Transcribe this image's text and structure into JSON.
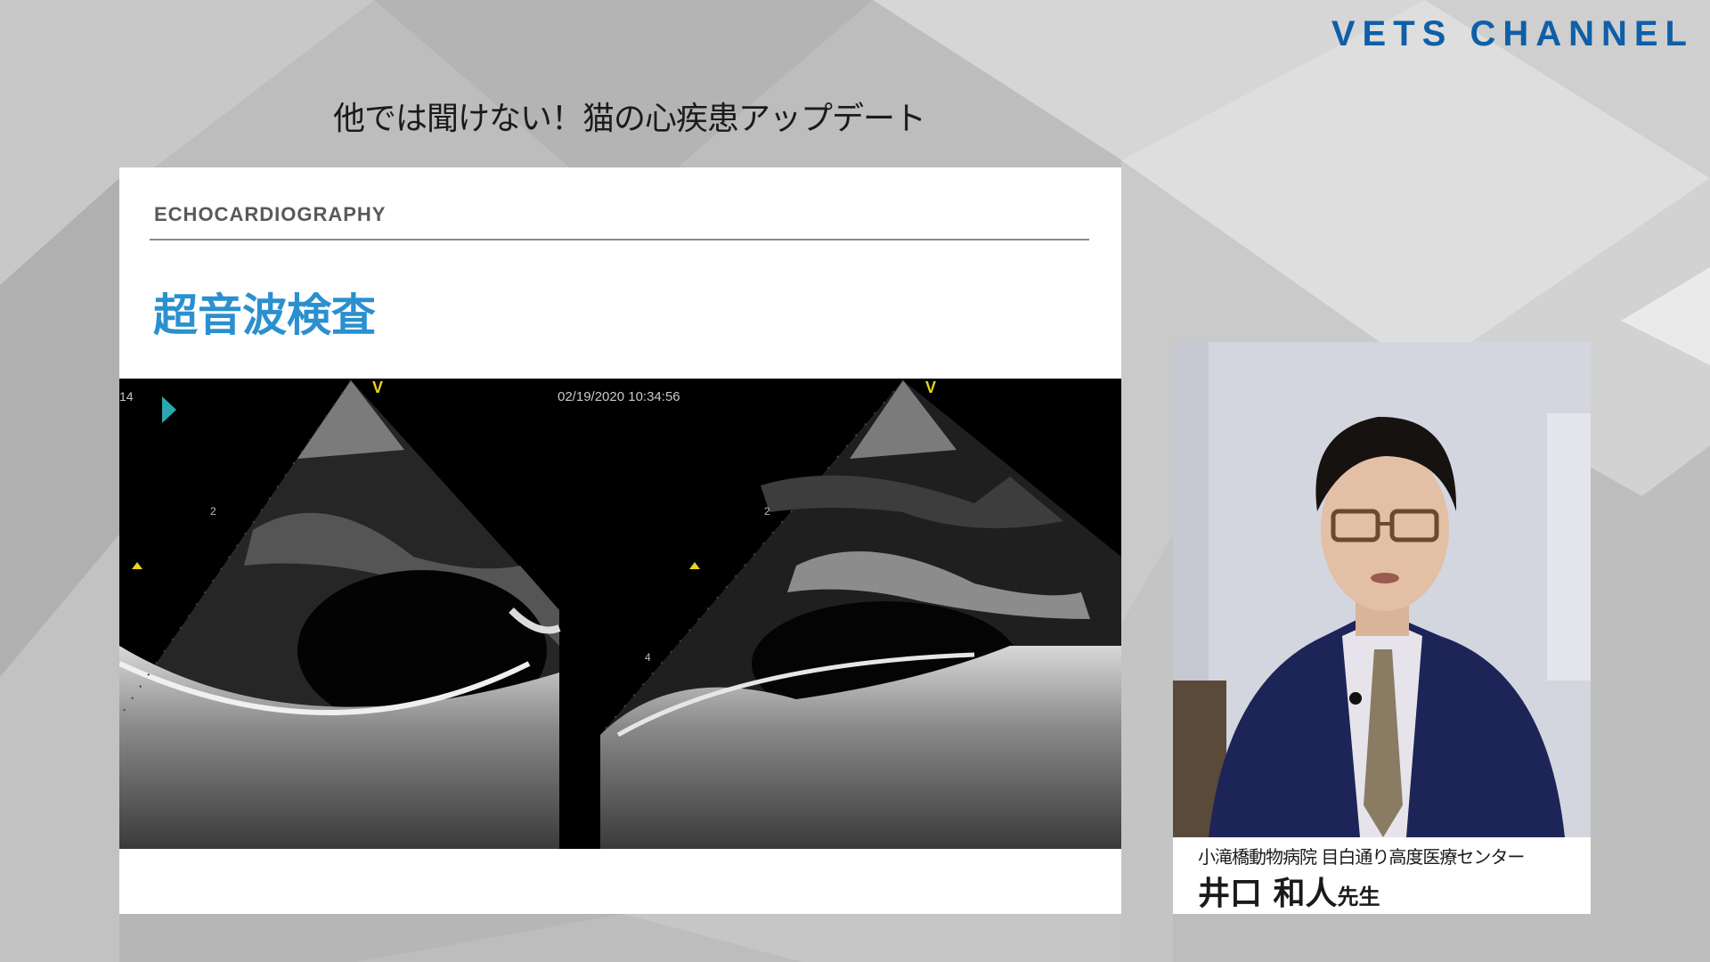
{
  "brand": {
    "logo_text": "VETS CHANNEL",
    "color": "#0f5fa8"
  },
  "course": {
    "title": "他では聞けない！猫の心疾患アップデート"
  },
  "slide": {
    "kicker": "ECHOCARDIOGRAPHY",
    "heading": "超音波検査",
    "heading_color": "#2a90cf",
    "echo": {
      "timestamp": "02/19/2020 10:34:56",
      "frame_number": "14",
      "probe_marker": "V",
      "depth_labels": [
        "2",
        "2",
        "4"
      ],
      "play_icon": "play-triangle-icon"
    }
  },
  "speaker": {
    "affiliation": "小滝橋動物病院 目白通り高度医療センター",
    "name": "井口 和人",
    "honorific": "先生"
  }
}
